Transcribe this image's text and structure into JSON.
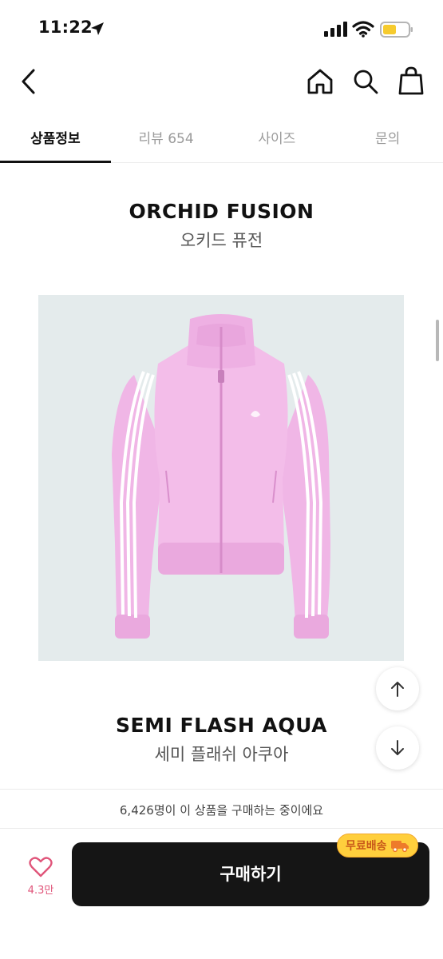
{
  "status_bar": {
    "time": "11:22"
  },
  "tabs": [
    {
      "label": "상품정보",
      "active": true
    },
    {
      "label": "리뷰 654",
      "active": false
    },
    {
      "label": "사이즈",
      "active": false
    },
    {
      "label": "문의",
      "active": false
    }
  ],
  "colors_section": {
    "first": {
      "name_en": "ORCHID FUSION",
      "name_ko": "오키드 퓨전"
    },
    "second": {
      "name_en": "SEMI FLASH AQUA",
      "name_ko": "세미 플래쉬 아쿠아"
    }
  },
  "notice": "6,426명이 이 상품을 구매하는 중이에요",
  "bottom_bar": {
    "like_count": "4.3만",
    "buy_label": "구매하기",
    "badge_label": "무료배송"
  },
  "theme": {
    "accent": "#151515",
    "badge_bg": "#ffcf3d",
    "badge_text": "#c9591a",
    "heart": "#e0557a",
    "product_bg": "#e4ebec",
    "jacket": "#f0b6e6"
  },
  "icons": [
    "location-arrow-icon",
    "signal-icon",
    "wifi-icon",
    "battery-icon",
    "back-icon",
    "home-icon",
    "search-icon",
    "shopping-bag-icon",
    "arrow-up-icon",
    "arrow-down-icon",
    "heart-icon",
    "truck-icon"
  ]
}
